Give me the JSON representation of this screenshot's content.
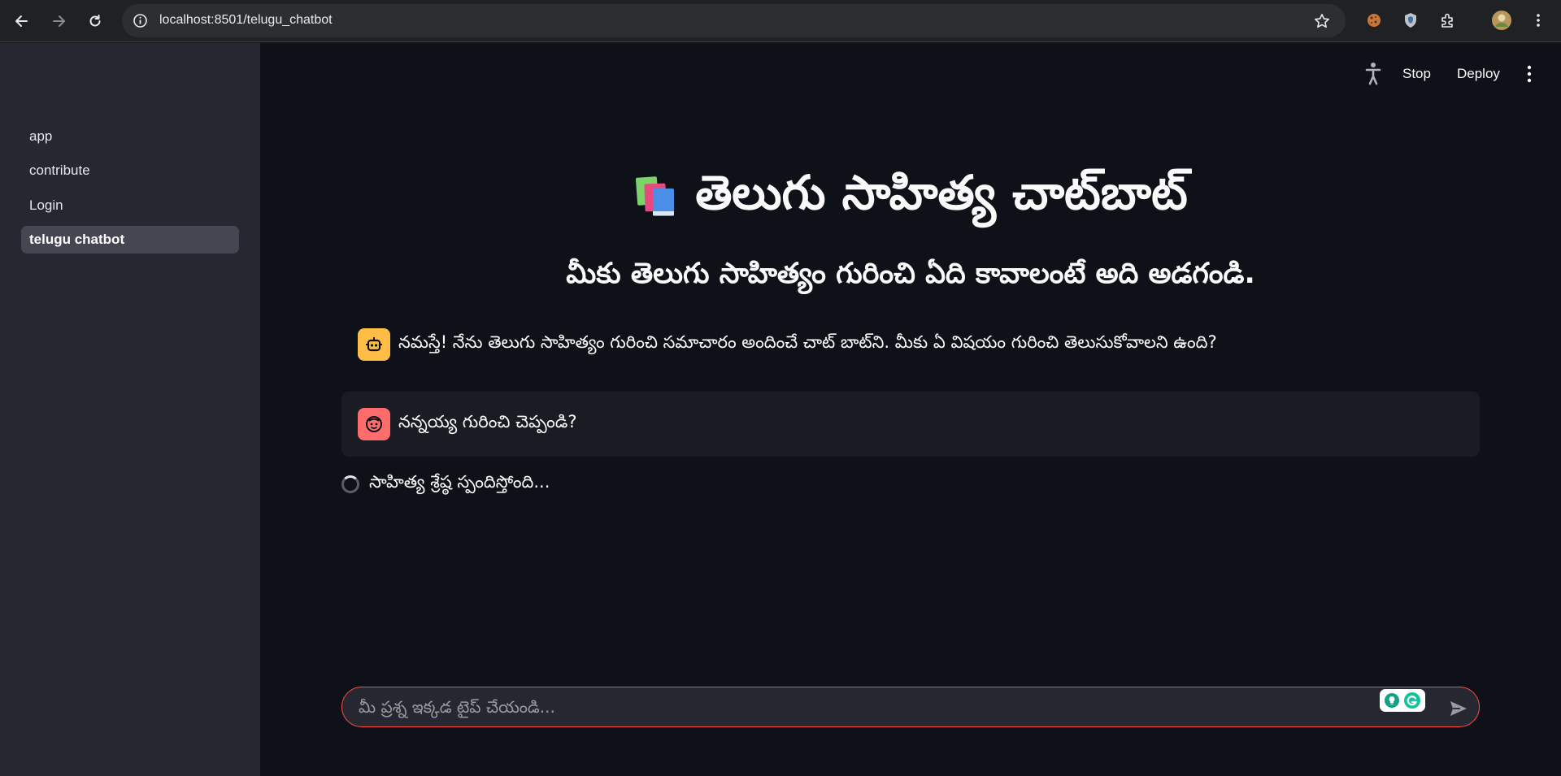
{
  "browser": {
    "url": "localhost:8501/telugu_chatbot"
  },
  "sidebar": {
    "items": [
      {
        "label": "app"
      },
      {
        "label": "contribute"
      },
      {
        "label": "Login"
      },
      {
        "label": "telugu chatbot",
        "active": true
      }
    ]
  },
  "topbar": {
    "stop_label": "Stop",
    "deploy_label": "Deploy"
  },
  "main": {
    "title": "తెలుగు సాహిత్య చాట్‌బాట్",
    "title_emoji": "books-icon",
    "subtitle": "మీకు తెలుగు సాహిత్యం గురించి ఏది కావాలంటే అది అడగండి."
  },
  "messages": [
    {
      "role": "assistant",
      "avatar": "robot-icon",
      "text": "నమస్తే! నేను తెలుగు సాహిత్యం గురించి సమాచారం అందించే చాట్ బాట్‌ని. మీకు ఏ విషయం గురించి తెలుసుకోవాలని ఉంది?"
    },
    {
      "role": "user",
      "avatar": "face-icon",
      "text": "నన్నయ్య గురించి చెప్పండి?"
    }
  ],
  "status": {
    "spinner_text": "సాహిత్య శ్రేష్ఠ స్పందిస్తోంది..."
  },
  "input": {
    "placeholder": "మీ ప్రశ్న ఇక్కడ టైప్ చేయండి..."
  },
  "colors": {
    "accent": "#ff4b4b",
    "assistant_avatar": "#ffbd45",
    "user_avatar": "#ff6c6c"
  }
}
